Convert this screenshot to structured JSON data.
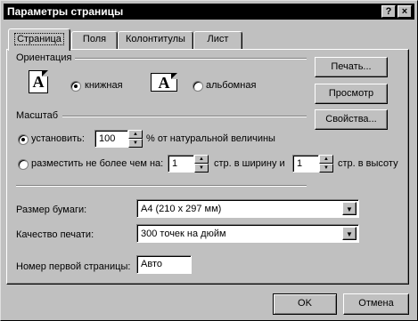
{
  "window": {
    "title": "Параметры страницы",
    "help_button": "?",
    "close_button": "×"
  },
  "tabs": [
    {
      "label": "Страница",
      "active": true
    },
    {
      "label": "Поля",
      "active": false
    },
    {
      "label": "Колонтитулы",
      "active": false
    },
    {
      "label": "Лист",
      "active": false
    }
  ],
  "orientation": {
    "group_label": "Ориентация",
    "portrait_label": "книжная",
    "landscape_label": "альбомная",
    "icon_letter": "A",
    "selected": "portrait"
  },
  "scale": {
    "group_label": "Масштаб",
    "adjust_label": "установить:",
    "adjust_value": "100",
    "adjust_suffix": "% от натуральной величины",
    "fit_label": "разместить не более чем на:",
    "fit_wide_value": "1",
    "fit_wide_suffix": "стр. в ширину и",
    "fit_tall_value": "1",
    "fit_tall_suffix": "стр. в высоту",
    "selected": "adjust"
  },
  "paper_size": {
    "label": "Размер бумаги:",
    "value": "A4 (210 x 297 мм)"
  },
  "print_quality": {
    "label": "Качество печати:",
    "value": "300 точек на дюйм"
  },
  "first_page": {
    "label": "Номер первой страницы:",
    "value": "Авто"
  },
  "side_buttons": {
    "print": "Печать...",
    "preview": "Просмотр",
    "properties": "Свойства..."
  },
  "footer": {
    "ok": "OK",
    "cancel": "Отмена"
  }
}
